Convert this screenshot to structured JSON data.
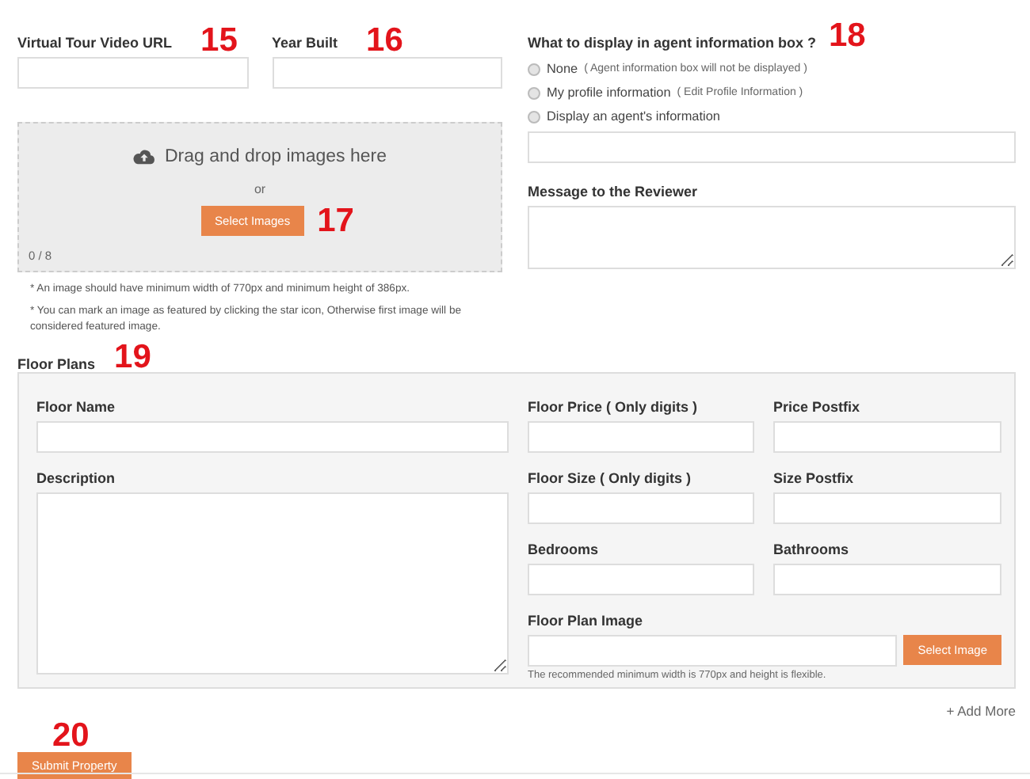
{
  "fields": [
    {
      "label": "Virtual Tour Video URL",
      "callout": "15"
    },
    {
      "label": "Year Built",
      "callout": "16"
    }
  ],
  "uploader": {
    "prompt": "Drag and drop images here",
    "or": "or",
    "button": "Select Images",
    "callout": "17",
    "count": "0 / 8"
  },
  "notes": [
    "* An image should have minimum width of 770px and minimum height of 386px.",
    "* You can mark an image as featured by clicking the star icon, Otherwise first image will be considered featured image."
  ],
  "agent_box": {
    "title": "What to display in agent information box ?",
    "callout": "18",
    "options": [
      {
        "label": "None",
        "hint": "( Agent information box will not be displayed )",
        "selected": false
      },
      {
        "label": "My profile information",
        "hint": "( Edit Profile Information )",
        "selected": false
      },
      {
        "label": "Display an agent's information",
        "selected": false
      }
    ]
  },
  "message": {
    "label": "Message to the Reviewer"
  },
  "floor_plans": {
    "title": "Floor Plans",
    "callout": "19",
    "name_label": "Floor Name",
    "description_label": "Description",
    "fields": [
      "Floor Price ( Only digits )",
      "Price Postfix",
      "Floor Size ( Only digits )",
      "Size Postfix",
      "Bedrooms",
      "Bathrooms"
    ],
    "image_label": "Floor Plan Image",
    "image_button": "Select Image",
    "image_hint": "The recommended minimum width is 770px and height is flexible.",
    "add_more": "+ Add More"
  },
  "submit": {
    "label": "Submit Property",
    "callout": "20"
  }
}
